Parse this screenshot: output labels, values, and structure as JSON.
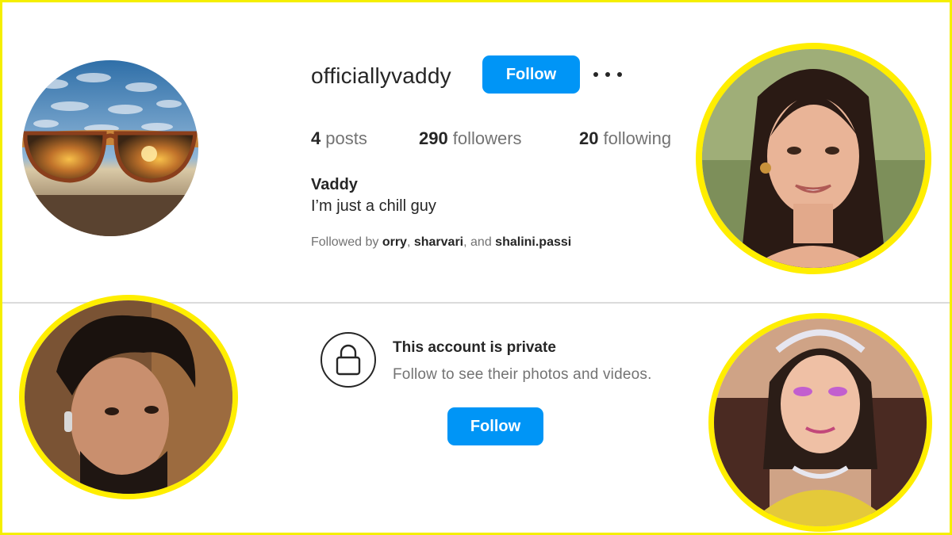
{
  "profile": {
    "username": "officiallyvaddy",
    "follow_label": "Follow",
    "more_icon": "more-options-icon",
    "stats": {
      "posts_count": "4",
      "posts_label": "posts",
      "followers_count": "290",
      "followers_label": "followers",
      "following_count": "20",
      "following_label": "following"
    },
    "display_name": "Vaddy",
    "bio": "I’m just a chill guy",
    "followed_by": {
      "prefix": "Followed by",
      "user1": "orry",
      "sep1": ",",
      "user2": "sharvari",
      "sep2": ", and",
      "user3": "shalini.passi"
    }
  },
  "private": {
    "lock_icon": "lock-icon",
    "title": "This account is private",
    "subtitle": "Follow to see their photos and videos.",
    "follow_label": "Follow"
  },
  "colors": {
    "follow_button": "#0095f6",
    "frame_border": "#f5ef00",
    "muted_text": "#737373",
    "primary_text": "#262626"
  }
}
